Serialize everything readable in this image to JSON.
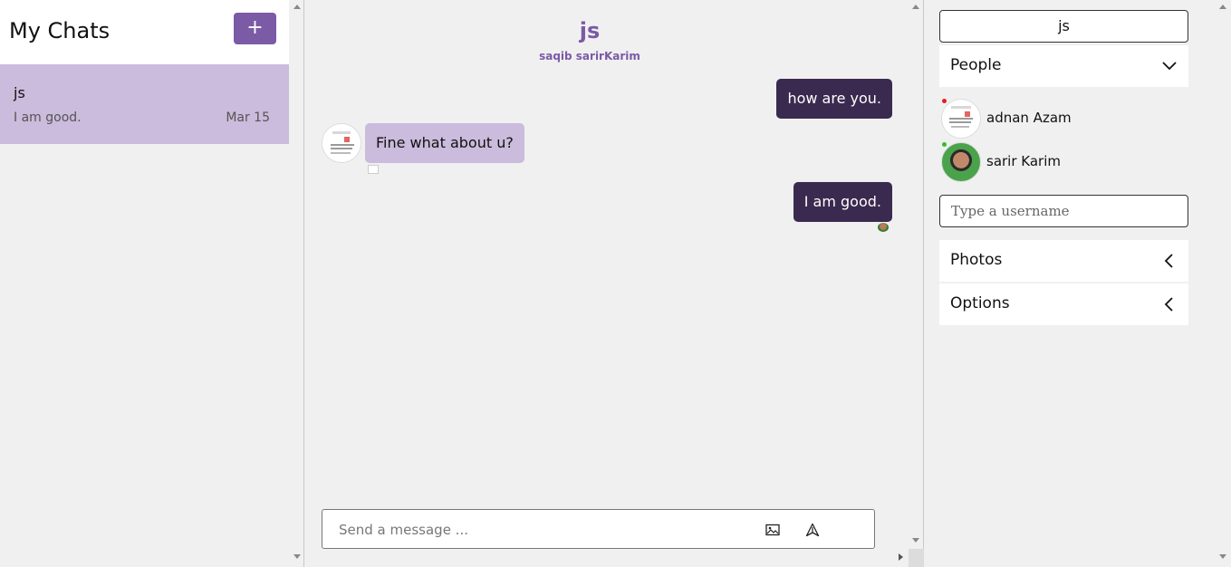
{
  "sidebar": {
    "title": "My Chats",
    "new_chat_label": "+",
    "chats": [
      {
        "title": "js",
        "last_message": "I am good.",
        "date": "Mar 15"
      }
    ]
  },
  "chat": {
    "title": "js",
    "subtitle": "saqib sarirKarim",
    "messages": [
      {
        "text": "how are you.",
        "direction": "outgoing"
      },
      {
        "text": "Fine what about u?",
        "direction": "incoming"
      },
      {
        "text": "I am good.",
        "direction": "outgoing"
      }
    ],
    "composer": {
      "placeholder": "Send a message ...",
      "attach_icon": "image-icon",
      "send_icon": "send-icon"
    }
  },
  "settings": {
    "chat_title": "js",
    "people_label": "People",
    "people": [
      {
        "name": "adnan Azam",
        "online": false
      },
      {
        "name": "sarir Karim",
        "online": true
      }
    ],
    "username_placeholder": "Type a username",
    "photos_label": "Photos",
    "options_label": "Options"
  },
  "colors": {
    "accent": "#7b5aa6",
    "outgoing_bubble": "#3b2a4f",
    "incoming_bubble": "#cbbbdc",
    "active_chat": "#cbbbdc",
    "background": "#f0f0f0"
  }
}
